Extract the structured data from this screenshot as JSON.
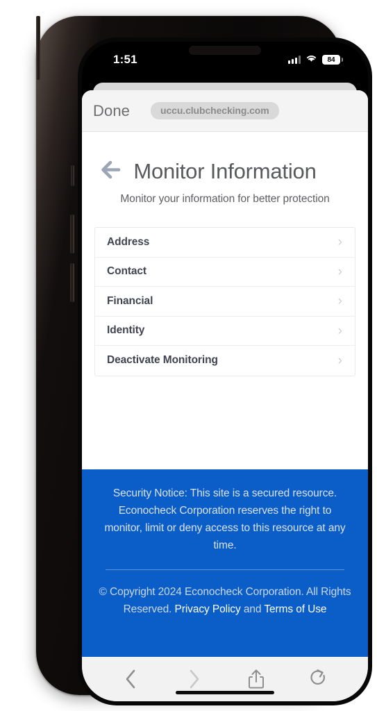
{
  "status_bar": {
    "time": "1:51",
    "battery_level": "84",
    "signal_icon": "cellular-signal-icon",
    "wifi_icon": "wifi-icon",
    "battery_icon": "battery-icon"
  },
  "browser": {
    "done_label": "Done",
    "url": "uccu.clubchecking.com",
    "toolbar": {
      "back_label": "back-icon",
      "forward_label": "forward-icon",
      "share_label": "share-icon",
      "reload_label": "reload-icon"
    }
  },
  "page": {
    "back_arrow_icon": "arrow-left-icon",
    "title": "Monitor Information",
    "subtitle": "Monitor your information for better protection",
    "menu_items": [
      {
        "label": "Address",
        "chevron": "›"
      },
      {
        "label": "Contact",
        "chevron": "›"
      },
      {
        "label": "Financial",
        "chevron": "›"
      },
      {
        "label": "Identity",
        "chevron": "›"
      },
      {
        "label": "Deactivate Monitoring",
        "chevron": "›"
      }
    ]
  },
  "footer": {
    "security_notice": "Security Notice: This site is a secured resource. Econocheck Corporation reserves the right to monitor, limit or deny access to this resource at any time.",
    "copyright_prefix": "© Copyright 2024 Econocheck Corporation. All Rights Reserved. ",
    "privacy_policy_label": "Privacy Policy",
    "copyright_conjunction": " and ",
    "terms_label": "Terms of Use"
  },
  "colors": {
    "footer_blue": "#0b5ec7",
    "title_gray": "#58595b",
    "row_text": "#3f4450",
    "back_arrow": "#9aa5b5"
  }
}
